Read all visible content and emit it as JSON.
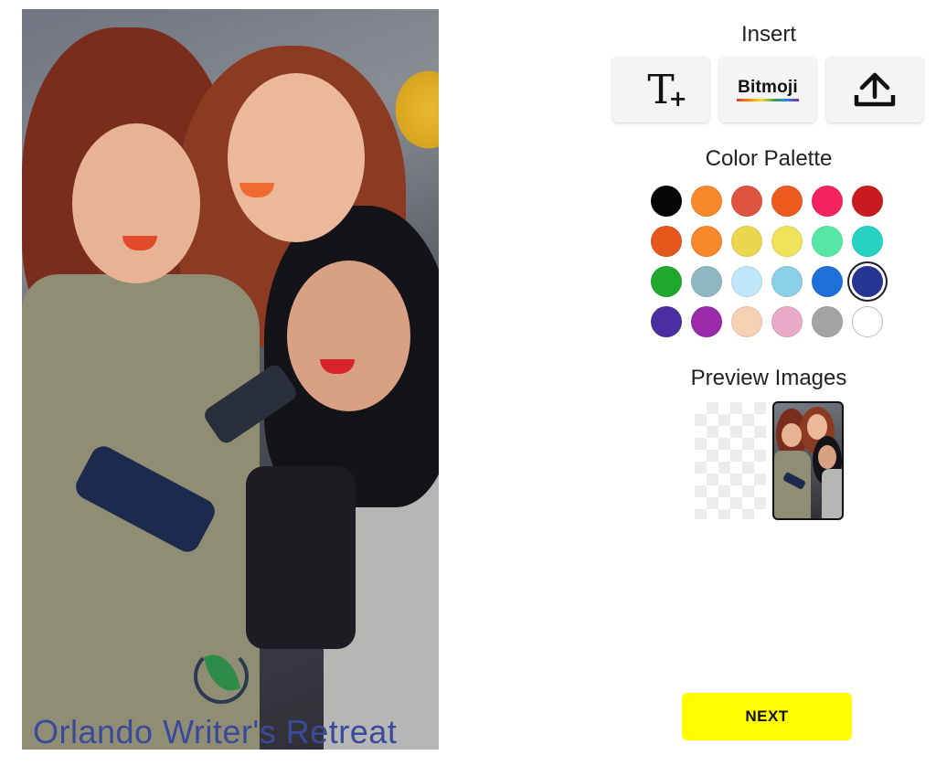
{
  "canvas": {
    "watermark_text": "Orlando Writer's Retreat",
    "watermark_logo_icon": "leaf-logo-icon"
  },
  "insert": {
    "title": "Insert",
    "buttons": [
      {
        "name": "add-text",
        "icon": "text-plus-icon",
        "label": "T"
      },
      {
        "name": "bitmoji",
        "icon": "bitmoji-logo",
        "label": "Bitmoji"
      },
      {
        "name": "upload",
        "icon": "upload-icon",
        "label": ""
      }
    ]
  },
  "palette": {
    "title": "Color Palette",
    "colors": [
      "#050505",
      "#f7892c",
      "#e05340",
      "#ef5a1f",
      "#f52460",
      "#c91b1f",
      "#e6571b",
      "#f7892c",
      "#ecd64f",
      "#f1e25c",
      "#58e6a8",
      "#26d3c3",
      "#20a82c",
      "#8fb7c2",
      "#bfe6f9",
      "#8ccfe8",
      "#1f6fd9",
      "#263494",
      "#4a2fa0",
      "#9a2aa8",
      "#f8d0b6",
      "#eaa9c8",
      "#a4a4a4",
      "#ffffff"
    ],
    "selected_index": 17
  },
  "preview": {
    "title": "Preview Images",
    "selected_index": 1
  },
  "next_label": "NEXT"
}
